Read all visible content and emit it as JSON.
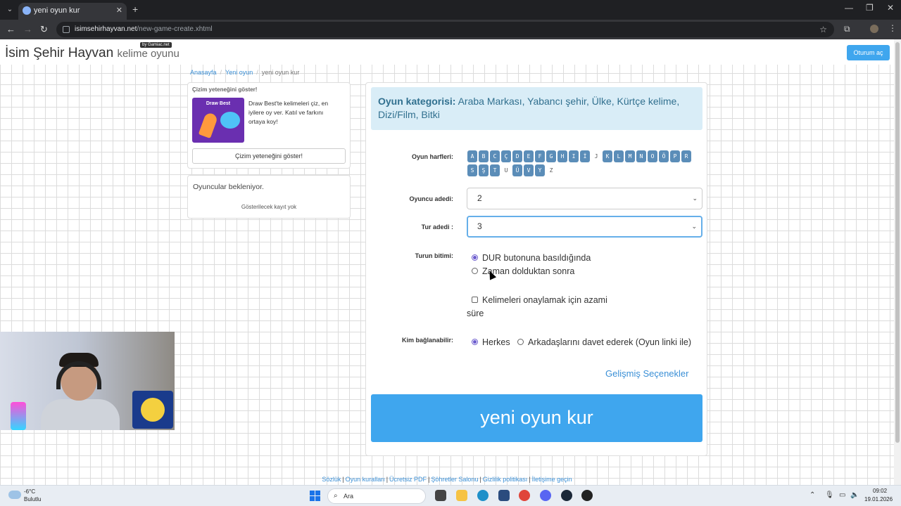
{
  "browser": {
    "tab_title": "yeni oyun kur",
    "tab_close": "✕",
    "new_tab": "+",
    "url_domain": "isimsehirhayvan.net",
    "url_path": "/new-game-create.xhtml"
  },
  "header": {
    "brand_title": "İsim Şehir Hayvan",
    "brand_subtitle": "kelime oyunu",
    "by_badge": "by Gamiac.net",
    "login_label": "Oturum aç"
  },
  "breadcrumb": {
    "home": "Anasayfa",
    "new_game": "Yeni oyun",
    "current": "yeni oyun kur"
  },
  "promo": {
    "title": "Çizim yeteneğini göster!",
    "image_title": "Draw Best",
    "text": "Draw Best'te kelimeleri çiz, en iyilere oy ver. Katıl ve farkını ortaya koy!",
    "button": "Çizim yeteneğini göster!"
  },
  "players_panel": {
    "title": "Oyuncular bekleniyor.",
    "empty": "Gösterilecek kayıt yok"
  },
  "form": {
    "category_label": "Oyun kategorisi:",
    "category_value": "Araba Markası, Yabancı şehir, Ülke, Kürtçe kelime, Dizi/Film, Bitki",
    "letters_label": "Oyun harfleri:",
    "letters": [
      {
        "ch": "A",
        "on": true
      },
      {
        "ch": "B",
        "on": true
      },
      {
        "ch": "C",
        "on": true
      },
      {
        "ch": "Ç",
        "on": true
      },
      {
        "ch": "D",
        "on": true
      },
      {
        "ch": "E",
        "on": true
      },
      {
        "ch": "F",
        "on": true
      },
      {
        "ch": "G",
        "on": true
      },
      {
        "ch": "H",
        "on": true
      },
      {
        "ch": "I",
        "on": true
      },
      {
        "ch": "İ",
        "on": true
      },
      {
        "ch": "J",
        "on": false
      },
      {
        "ch": "K",
        "on": true
      },
      {
        "ch": "L",
        "on": true
      },
      {
        "ch": "M",
        "on": true
      },
      {
        "ch": "N",
        "on": true
      },
      {
        "ch": "O",
        "on": true
      },
      {
        "ch": "Ö",
        "on": true
      },
      {
        "ch": "P",
        "on": true
      },
      {
        "ch": "R",
        "on": true
      },
      {
        "ch": "S",
        "on": true
      },
      {
        "ch": "Ş",
        "on": true
      },
      {
        "ch": "T",
        "on": true
      },
      {
        "ch": "U",
        "on": false
      },
      {
        "ch": "Ü",
        "on": true
      },
      {
        "ch": "V",
        "on": true
      },
      {
        "ch": "Y",
        "on": true
      },
      {
        "ch": "Z",
        "on": false
      }
    ],
    "players_label": "Oyuncu adedi:",
    "players_value": "2",
    "rounds_label": "Tur adedi :",
    "rounds_value": "3",
    "round_end_label": "Turun bitimi:",
    "round_end_option1": "DUR butonuna basıldığında",
    "round_end_option2": "Zaman dolduktan sonra",
    "max_time_label": "Kelimeleri onaylamak için azami süre",
    "who_label": "Kim bağlanabilir:",
    "who_option1": "Herkes",
    "who_option2": "Arkadaşlarını davet ederek (Oyun linki ile)",
    "advanced": "Gelişmiş Seçenekler",
    "create_button": "yeni oyun kur"
  },
  "footer": {
    "links": [
      "Sözlük",
      "Oyun kuralları",
      "Ücretsiz PDF",
      "Şöhretler Salonu",
      "Gizlilik politikası",
      "İletişime geçin"
    ],
    "separator": "|"
  },
  "taskbar": {
    "temperature": "-6°C",
    "weather": "Bulutlu",
    "search": "Ara",
    "time": "09:02",
    "date": "19.01.2026"
  },
  "colors": {
    "accent": "#3fa6ee",
    "category_bg": "#d9edf7",
    "letter_bg": "#5b8db8",
    "radio_checked": "#6a5acd"
  }
}
